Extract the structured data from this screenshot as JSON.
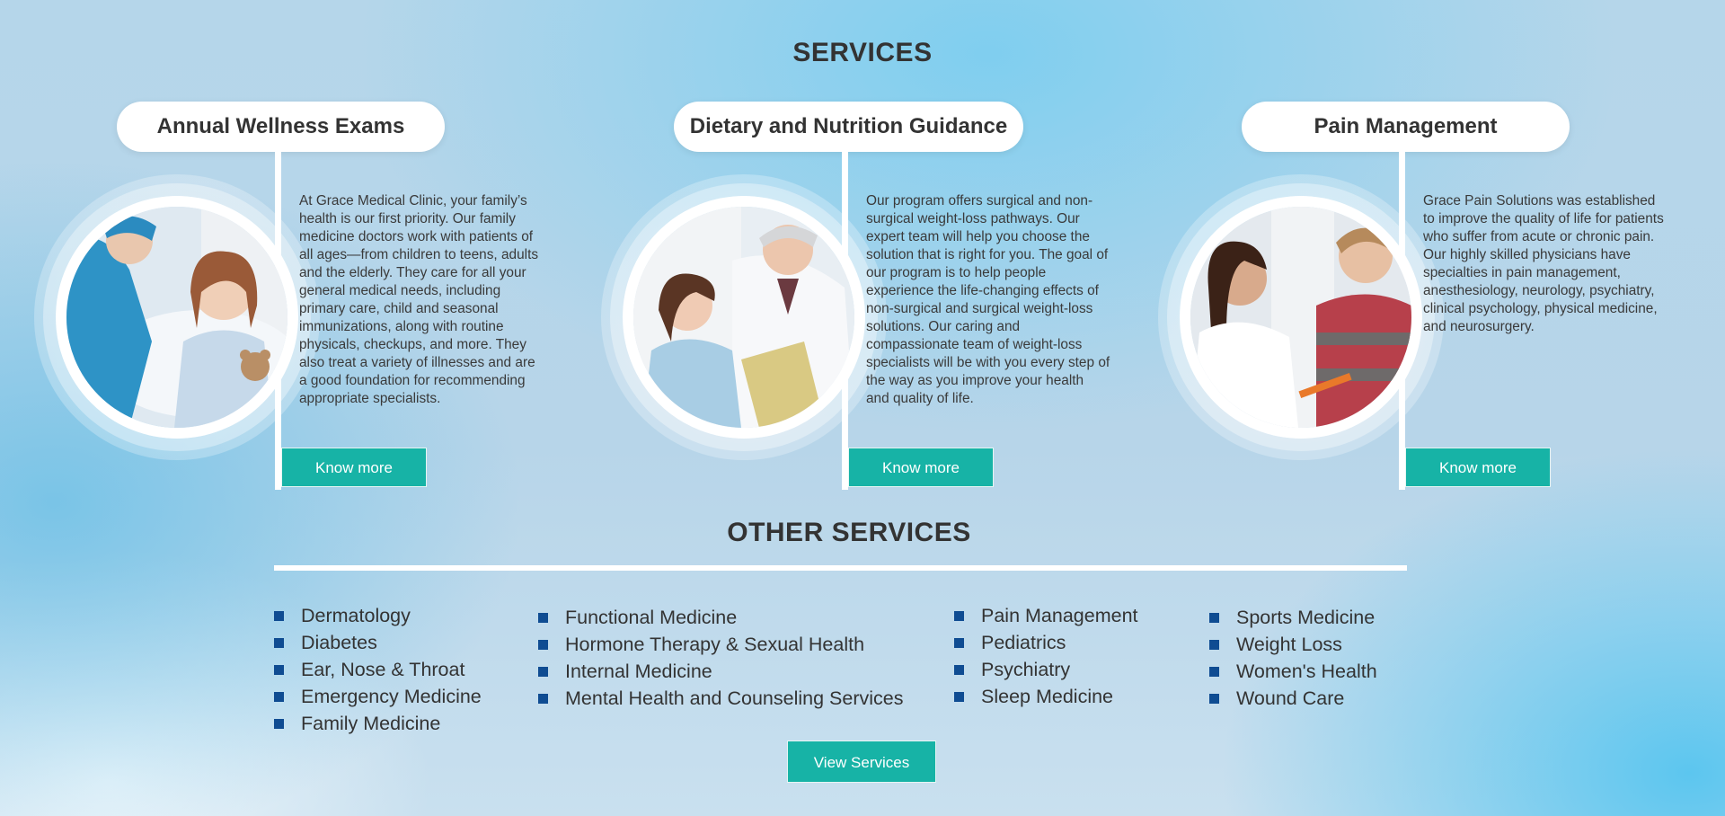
{
  "services": {
    "title": "SERVICES",
    "cards": [
      {
        "title": "Annual Wellness Exams",
        "description": "At Grace Medical Clinic, your family’s health is our first priority. Our family medicine doctors work with patients of all ages—from children to teens, adults and the elderly. They care for all your general medical needs, including primary care, child and seasonal immunizations, along with routine physicals, checkups, and more. They also treat a variety of illnesses and are a good foundation for recommending appropriate specialists.",
        "button": "Know more"
      },
      {
        "title": "Dietary and Nutrition Guidance",
        "description": "Our program offers surgical and non-surgical weight-loss pathways. Our expert team will help you choose the solution that is right for you. The goal of our program is to help people experience the life-changing effects of non-surgical and surgical weight-loss solutions. Our caring and compassionate team of weight-loss specialists will be with you every step of the way as you improve your health and quality of life.",
        "button": "Know more"
      },
      {
        "title": "Pain Management",
        "description": "Grace Pain Solutions was established to improve the quality of life for patients who suffer from acute or chronic pain. Our highly skilled physicians have specialties in pain management, anesthesiology, neurology, psychiatry, clinical psychology, physical medicine, and neurosurgery.",
        "button": "Know more"
      }
    ]
  },
  "other_services": {
    "title": "OTHER SERVICES",
    "columns": [
      [
        "Dermatology",
        "Diabetes",
        "Ear, Nose & Throat",
        "Emergency Medicine",
        "Family Medicine"
      ],
      [
        "Functional Medicine",
        "Hormone Therapy & Sexual Health",
        "Internal Medicine",
        "Mental Health and Counseling Services"
      ],
      [
        "Pain Management",
        "Pediatrics",
        "Psychiatry",
        "Sleep Medicine"
      ],
      [
        "Sports Medicine",
        "Weight Loss",
        "Women's Health",
        "Wound Care"
      ]
    ],
    "button": "View Services"
  },
  "colors": {
    "accent": "#17b3a6",
    "bullet": "#0f4c92",
    "text": "#333333"
  }
}
